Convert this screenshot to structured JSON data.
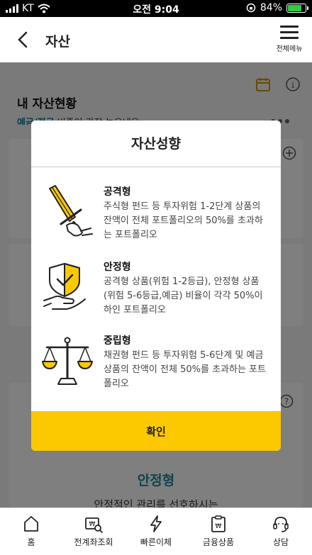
{
  "status_bar": {
    "carrier": "KT",
    "time": "오전 9:04",
    "battery": "84%",
    "battery_level": 0.84,
    "icons": [
      "signal-icon",
      "wifi-icon",
      "orientation-lock-icon",
      "battery-icon"
    ]
  },
  "header": {
    "title": "자산",
    "menu_label": "전체메뉴"
  },
  "background": {
    "section_title": "내 자산현황",
    "subtitle_highlight": "예금/적금",
    "subtitle_rest": " 비중이 가장 높으네요",
    "type_label": "안정형",
    "type_desc": "안정적인 관리를 선호하시는"
  },
  "modal": {
    "title": "자산성향",
    "items": [
      {
        "name": "공격형",
        "desc": "주식형 펀드 등 투자위험 1-2단계 상품의 잔액이 전체 포트폴리오의 50%를 초과하는 포트폴리오",
        "icon": "sword-icon"
      },
      {
        "name": "안정형",
        "desc": "공격형 상품(위험 1-2등급), 안정형 상품(위험 5-6등급,예금) 비율이 각각 50%이하인 포트폴리오",
        "icon": "shield-hand-icon"
      },
      {
        "name": "중립형",
        "desc": "채권형 펀드 등 투자위험 5-6단계 및 예금 상품의 잔액이 전체 50%를 초과하는 포트폴리오",
        "icon": "balance-scale-icon"
      }
    ],
    "confirm_label": "확인"
  },
  "tabbar": {
    "items": [
      {
        "label": "홈",
        "icon": "home-icon"
      },
      {
        "label": "전계좌조회",
        "icon": "account-search-icon"
      },
      {
        "label": "빠른이체",
        "icon": "lightning-icon"
      },
      {
        "label": "금융상품",
        "icon": "financial-product-icon"
      },
      {
        "label": "상담",
        "icon": "headset-icon"
      }
    ]
  },
  "colors": {
    "accent_yellow": "#fcc800",
    "teal": "#1a8b9c",
    "overlay": "rgba(0,0,0,0.5)"
  }
}
